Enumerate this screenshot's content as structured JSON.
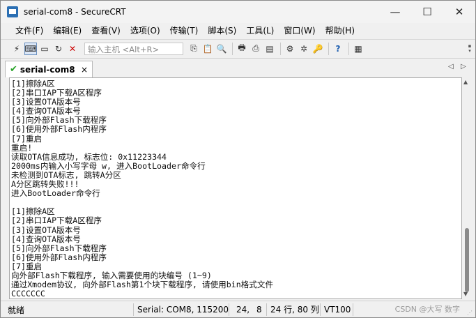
{
  "window": {
    "title": "serial-com8 - SecureCRT",
    "controls": {
      "minimize": "—",
      "maximize": "☐",
      "close": "✕"
    }
  },
  "menu": [
    "文件(F)",
    "编辑(E)",
    "查看(V)",
    "选项(O)",
    "传输(T)",
    "脚本(S)",
    "工具(L)",
    "窗口(W)",
    "帮助(H)"
  ],
  "toolbar": {
    "quick_connect_placeholder": "输入主机 <Alt+R>"
  },
  "tab": {
    "label": "serial-com8",
    "close": "×",
    "prev": "◁",
    "next": "▷"
  },
  "terminal": {
    "lines": [
      "[1]擦除A区",
      "[2]串口IAP下载A区程序",
      "[3]设置OTA版本号",
      "[4]查询OTA版本号",
      "[5]向外部Flash下载程序",
      "[6]使用外部Flash内程序",
      "[7]重启",
      "重启!",
      "读取OTA信息成功, 标志位: 0x11223344",
      "2000ms内输入小写字母 w, 进入BootLoader命令行",
      "未检测到OTA标志, 跳转A分区",
      "A分区跳转失败!!!",
      "进入BootLoader命令行",
      "",
      "[1]擦除A区",
      "[2]串口IAP下载A区程序",
      "[3]设置OTA版本号",
      "[4]查询OTA版本号",
      "[5]向外部Flash下载程序",
      "[6]使用外部Flash内程序",
      "[7]重启",
      "向外部Flash下载程序, 输入需要使用的块编号 (1~9)",
      "通过Xmodem协议, 向外部Flash第1个块下载程序, 请使用bin格式文件",
      "CCCCCCC"
    ]
  },
  "status": {
    "ready": "就绪",
    "connection": "Serial: COM8, 115200",
    "cursor_row": "24,",
    "cursor_col": "8",
    "size": "24 行, 80 列",
    "emulation": "VT100",
    "watermark": "CSDN @大写  数字"
  }
}
